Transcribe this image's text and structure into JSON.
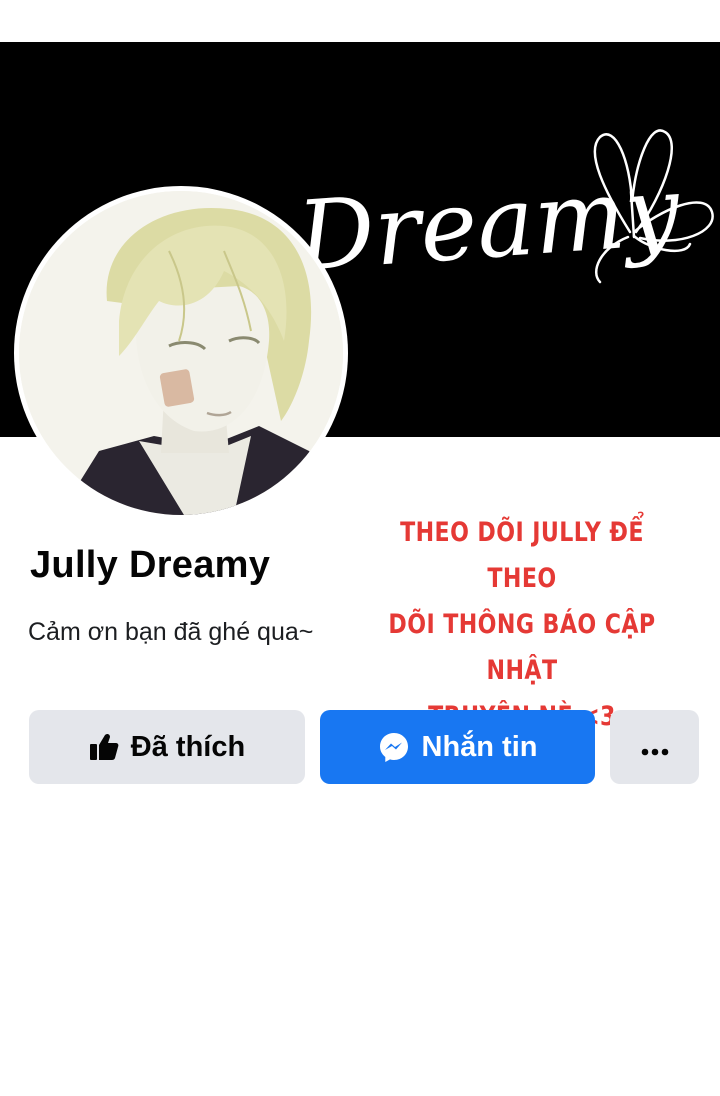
{
  "cover": {
    "script_text": "Dreamy",
    "background": "#000000",
    "decoration": "butterfly-icon"
  },
  "profile": {
    "name": "Jully Dreamy",
    "bio": "Cảm ơn bạn đã ghé qua~"
  },
  "promo": {
    "lines": [
      "THEO DÕI JULLY ĐỂ THEO",
      "DÕI THÔNG BÁO CẬP NHẬT",
      "TRUYỆN NÈ <3"
    ],
    "color": "#e53935"
  },
  "actions": {
    "liked_label": "Đã thích",
    "liked_icon": "thumbs-up-icon",
    "message_label": "Nhắn tin",
    "message_icon": "messenger-icon",
    "more_icon": "more-dots-icon"
  },
  "colors": {
    "primary": "#1877f2",
    "secondary_button": "#e4e6eb",
    "text": "#050505"
  }
}
